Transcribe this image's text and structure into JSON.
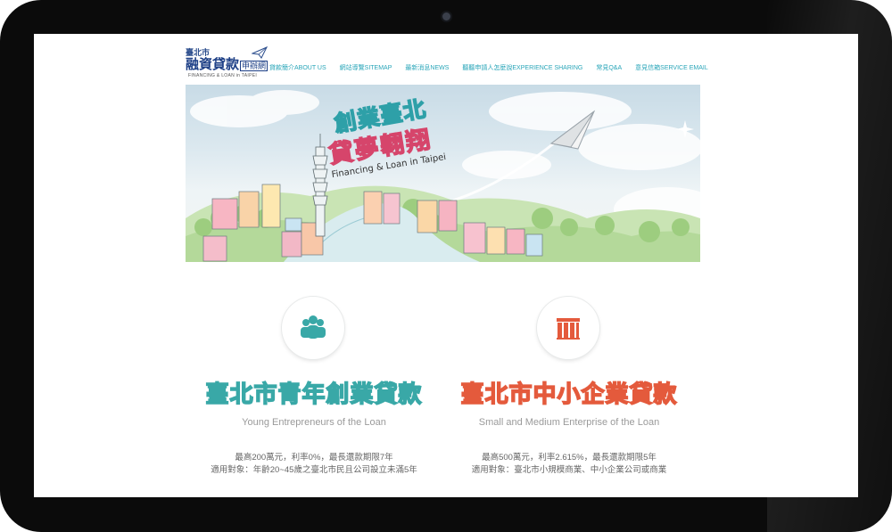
{
  "site": {
    "logo": {
      "small": "臺北市",
      "main": "融資貸款",
      "badge": "申辦網",
      "en": "FINANCING & LOAN in TAIPEI"
    },
    "nav": [
      {
        "label": "貸款簡介ABOUT US"
      },
      {
        "label": "網站導覽SITEMAP"
      },
      {
        "label": "最新消息NEWS"
      },
      {
        "label": "聽聽申請人怎麼說EXPERIENCE SHARING"
      },
      {
        "label": "常見Q&A"
      },
      {
        "label": "意見信箱SERVICE EMAIL"
      }
    ]
  },
  "banner": {
    "title_line1": "創業臺北",
    "title_line2": "貸夢翱翔",
    "title_en": "Financing & Loan in Taipei"
  },
  "loans": [
    {
      "icon": "people-icon",
      "title": "臺北市青年創業貸款",
      "subtitle": "Young Entrepreneurs of the Loan",
      "desc_line1": "最高200萬元，利率0%，最長還款期限7年",
      "desc_line2": "適用對象：年齡20~45歲之臺北市民且公司設立未滿5年",
      "color": "#39a8a7"
    },
    {
      "icon": "building-icon",
      "title": "臺北市中小企業貸款",
      "subtitle": "Small and Medium Enterprise of the Loan",
      "desc_line1": "最高500萬元，利率2.615%，最長還款期限5年",
      "desc_line2": "適用對象：臺北市小規模商業、中小企業公司或商業",
      "color": "#e45a3c"
    }
  ]
}
